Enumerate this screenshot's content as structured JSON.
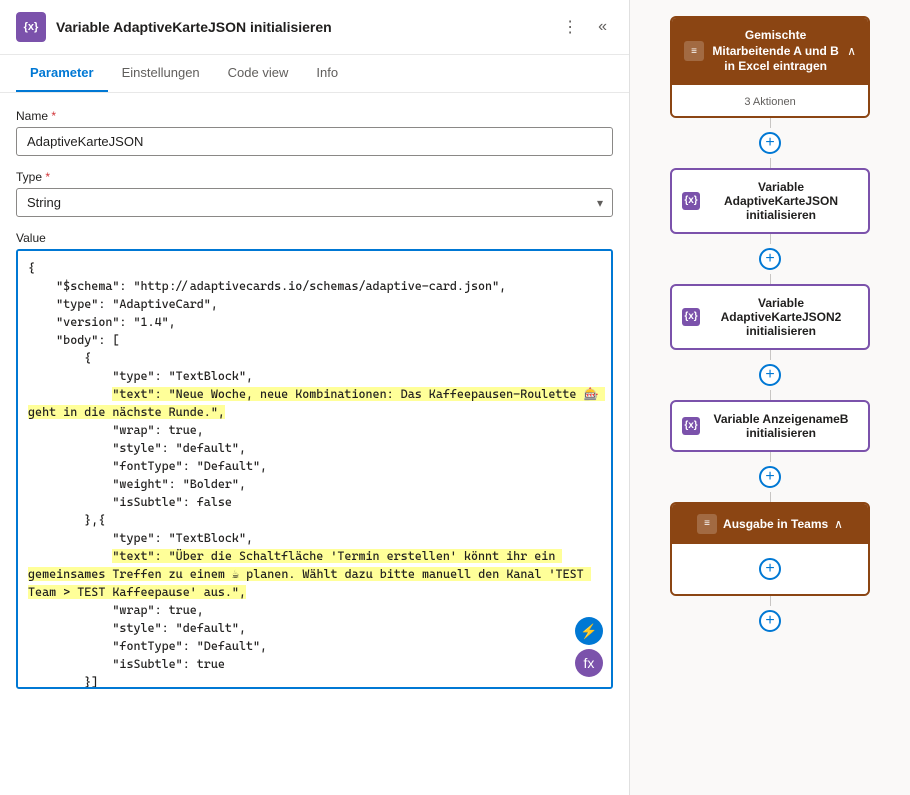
{
  "header": {
    "icon": "{x}",
    "title": "Variable AdaptiveKarteJSON initialisieren",
    "more_btn": "⋮",
    "collapse_btn": "«"
  },
  "tabs": [
    {
      "label": "Parameter",
      "active": true
    },
    {
      "label": "Einstellungen",
      "active": false
    },
    {
      "label": "Code view",
      "active": false
    },
    {
      "label": "Info",
      "active": false
    }
  ],
  "form": {
    "name_label": "Name",
    "name_value": "AdaptiveKarteJSON",
    "type_label": "Type",
    "type_value": "String",
    "value_label": "Value",
    "code_content": "{\n    \"$schema\": \"http://adaptivecards.io/schemas/adaptive-card.json\",\n    \"type\": \"AdaptiveCard\",\n    \"version\": \"1.4\",\n    \"body\": [\n        {\n            \"type\": \"TextBlock\",\n            \"text\": \"Neue Woche, neue Kombinationen: Das Kaffeepausen-Roulette 🎰 geht in die nächste Runde.\",\n            \"wrap\": true,\n            \"style\": \"default\",\n            \"fontType\": \"Default\",\n            \"weight\": \"Bolder\",\n            \"isSubtle\": false\n        },{\n            \"type\": \"TextBlock\",\n            \"text\": \"Über die Schaltfläche 'Termin erstellen' könnt ihr ein gemeinsames Treffen zu einem ☕ planen. Wählt dazu bitte manuell den Kanal 'TEST Team > TEST Kaffeepause' aus.\",\n            \"wrap\": true,\n            \"style\": \"default\",\n            \"fontType\": \"Default\",\n            \"isSubtle\": true\n        }]",
    "float_btn1": "⚡",
    "float_btn2": "fx"
  },
  "flow": {
    "node1": {
      "header_title": "Gemischte Mitarbeitende A und B in Excel eintragen",
      "body_text": "3 Aktionen",
      "collapse_icon": "∧"
    },
    "node2": {
      "icon": "{x}",
      "title": "Variable AdaptiveKarteJSON initialisieren"
    },
    "node3": {
      "icon": "{x}",
      "title": "Variable AdaptiveKarteJSON2 initialisieren"
    },
    "node4": {
      "icon": "{x}",
      "title": "Variable AnzeigenameB initialisieren"
    },
    "node5": {
      "header_title": "Ausgabe in Teams",
      "collapse_icon": "∧"
    },
    "plus_btn": "+"
  }
}
